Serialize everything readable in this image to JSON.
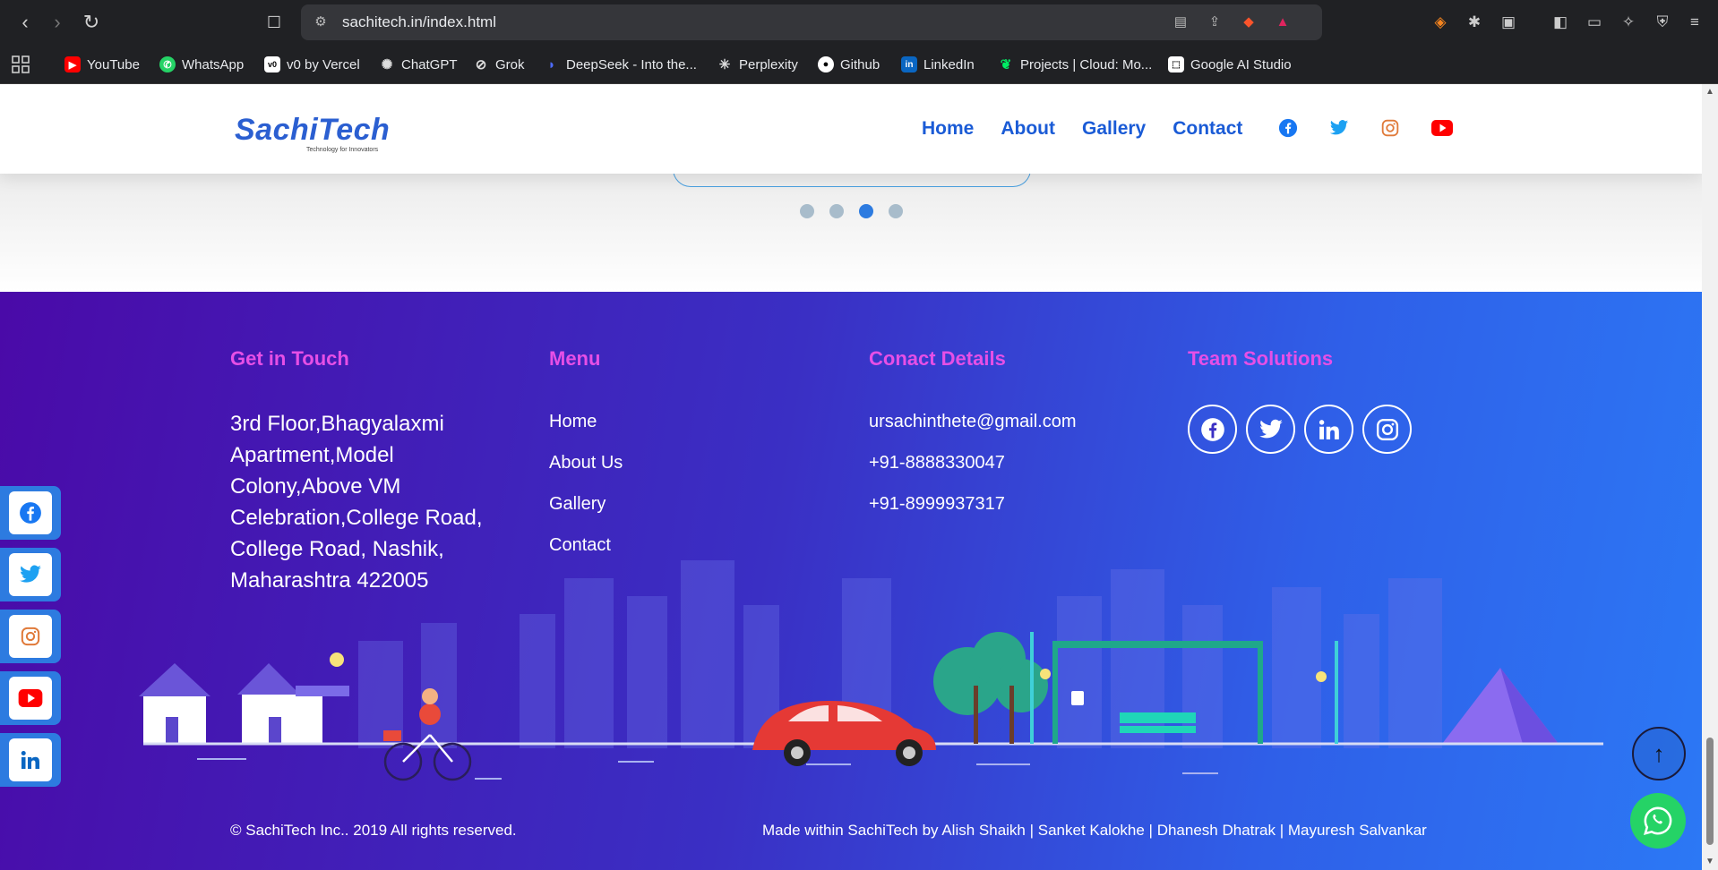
{
  "browser": {
    "url": "sachitech.in/index.html",
    "bookmarks": [
      {
        "label": "YouTube",
        "color": "#ff0000"
      },
      {
        "label": "WhatsApp",
        "color": "#25d366"
      },
      {
        "label": "v0 by Vercel",
        "color": "#ffffff"
      },
      {
        "label": "ChatGPT",
        "color": "#cccccc"
      },
      {
        "label": "Grok",
        "color": "#cccccc"
      },
      {
        "label": "DeepSeek - Into the...",
        "color": "#4d6bfe"
      },
      {
        "label": "Perplexity",
        "color": "#ffffff"
      },
      {
        "label": "Github",
        "color": "#ffffff"
      },
      {
        "label": "LinkedIn",
        "color": "#0a66c2"
      },
      {
        "label": "Projects | Cloud: Mo...",
        "color": "#00ed64"
      },
      {
        "label": "Google AI Studio",
        "color": "#ffffff"
      }
    ]
  },
  "header": {
    "logo": "SachiTech",
    "logo_tagline": "Technology for Innovators",
    "nav": [
      "Home",
      "About",
      "Gallery",
      "Contact"
    ],
    "social_colors": {
      "facebook": "#1877f2",
      "twitter": "#1da1f2",
      "instagram": "#e1306c",
      "youtube": "#ff0000"
    }
  },
  "carousel": {
    "active_dot": 3,
    "dot_count": 4
  },
  "footer": {
    "get_in_touch": {
      "title": "Get in Touch",
      "address": "3rd Floor,Bhagyalaxmi Apartment,Model Colony,Above VM Celebration,College Road, College Road, Nashik, Maharashtra 422005"
    },
    "menu": {
      "title": "Menu",
      "items": [
        "Home",
        "About Us",
        "Gallery",
        "Contact"
      ]
    },
    "contact": {
      "title": "Conact Details",
      "email": "ursachinthete@gmail.com",
      "phone1": "+91-8888330047",
      "phone2": "+91-8999937317"
    },
    "team": {
      "title": "Team Solutions"
    },
    "copyright": "© SachiTech Inc.. 2019 All rights reserved.",
    "made_by": "Made within SachiTech by Alish Shaikh | Sanket Kalokhe | Dhanesh Dhatrak | Mayuresh Salvankar"
  },
  "colors": {
    "accent": "#1a5bd6",
    "footer_title": "#e64fe6",
    "whatsapp": "#25d366"
  }
}
